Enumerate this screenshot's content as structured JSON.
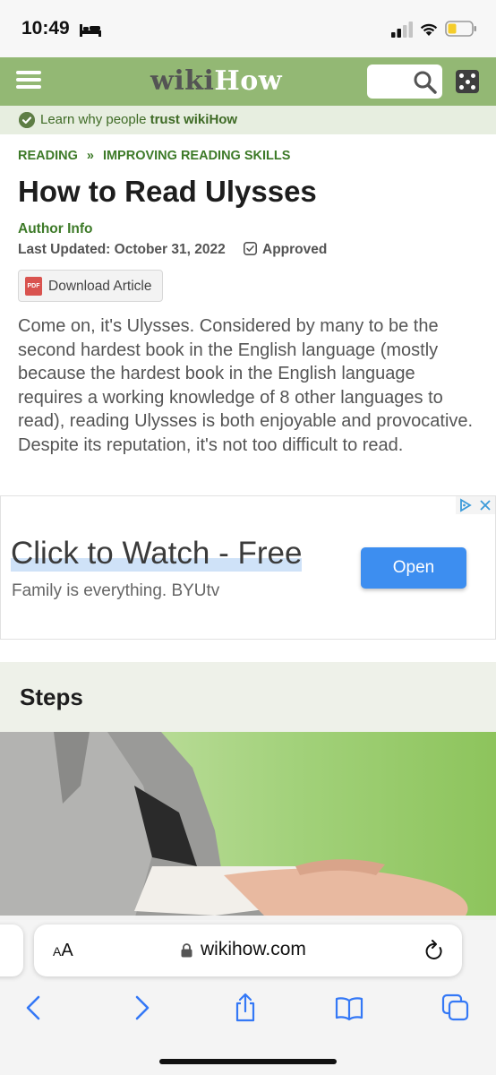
{
  "status_bar": {
    "time": "10:49"
  },
  "header": {
    "logo_wiki": "wiki",
    "logo_how": "How",
    "brand_color": "#93b874"
  },
  "trust_bar": {
    "text": "Learn why people ",
    "emphasis": "trust wikiHow"
  },
  "article": {
    "breadcrumb": [
      "READING",
      "IMPROVING READING SKILLS"
    ],
    "breadcrumb_separator": "»",
    "title": "How to Read Ulysses",
    "author_info": "Author Info",
    "last_updated": "Last Updated: October 31, 2022",
    "approved": "Approved",
    "download_label": "Download Article",
    "pdf_badge": "PDF",
    "intro": "Come on, it's Ulysses. Considered by many to be the second hardest book in the English language (mostly because the hardest book in the English language requires a working knowledge of 8 other languages to read), reading Ulysses is both enjoyable and provocative. Despite its reputation, it's not too difficult to read."
  },
  "ad": {
    "headline": "Click to Watch - Free",
    "subline": "Family is everything. BYUtv",
    "button": "Open",
    "button_color": "#3d8ef0"
  },
  "steps": {
    "heading": "Steps"
  },
  "safari": {
    "text_size_label_small": "A",
    "text_size_label_large": "A",
    "url": "wikihow.com"
  }
}
